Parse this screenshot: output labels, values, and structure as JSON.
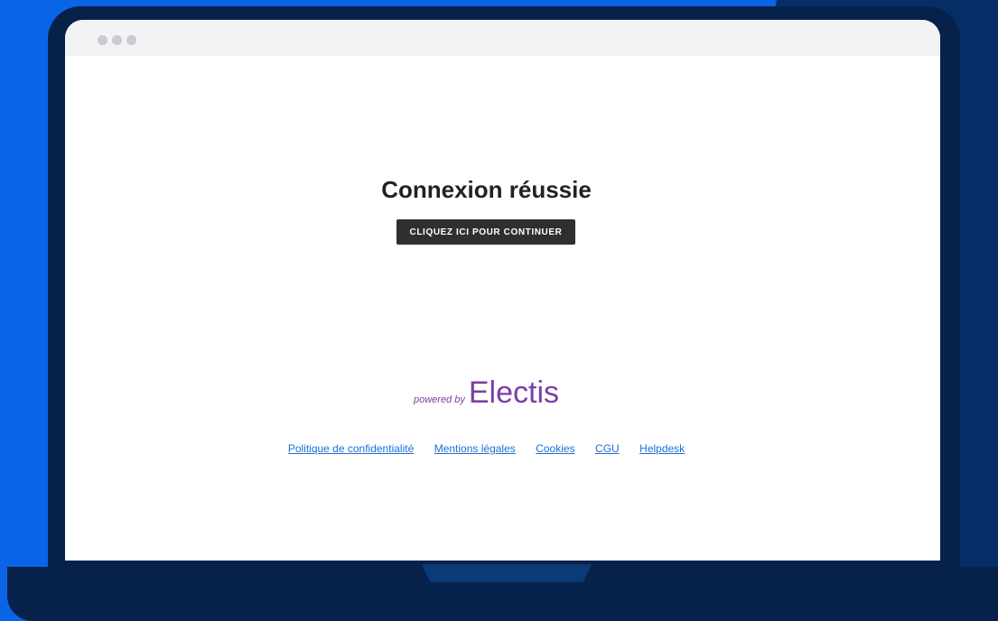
{
  "page": {
    "heading": "Connexion réussie",
    "continue_button": "CLIQUEZ ICI POUR CONTINUER",
    "powered_by_prefix": "powered by",
    "brand_name": "Electis"
  },
  "footer": {
    "links": [
      "Politique de confidentialité",
      "Mentions légales",
      "Cookies",
      "CGU",
      "Helpdesk"
    ]
  },
  "colors": {
    "background_blue": "#0a64e8",
    "laptop_navy": "#06224a",
    "button_dark": "#2f2f2f",
    "brand_purple": "#7b3fa6",
    "link_blue": "#1a6fd6"
  }
}
